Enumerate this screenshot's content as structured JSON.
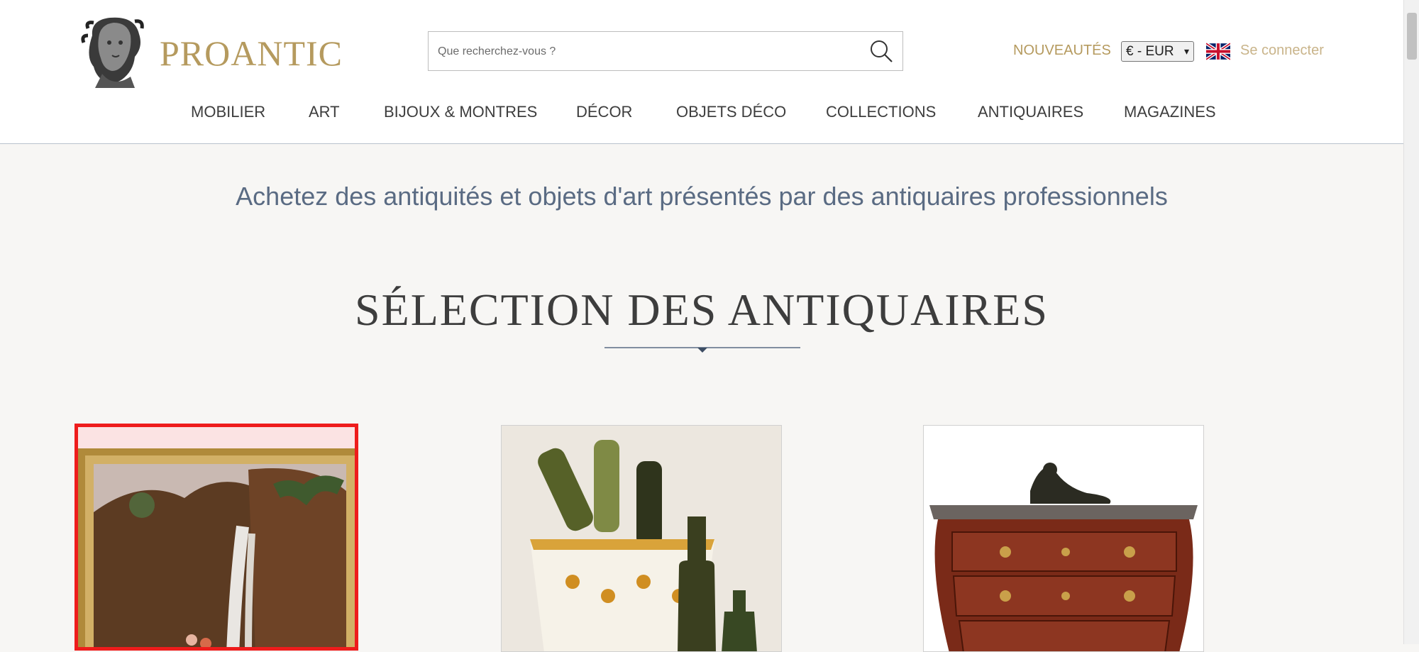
{
  "brand": {
    "name": "PROANTIC",
    "logo_icon": "sculpted-bust-icon"
  },
  "search": {
    "placeholder": "Que recherchez-vous ?",
    "icon": "search-icon"
  },
  "header_links": {
    "news": "NOUVEAUTÉS",
    "login": "Se connecter"
  },
  "currency": {
    "selected": "€ - EUR",
    "icon": "chevron-down-icon"
  },
  "language": {
    "icon": "uk-flag-icon"
  },
  "nav": {
    "items": [
      {
        "label": "MOBILIER"
      },
      {
        "label": "ART"
      },
      {
        "label": "BIJOUX & MONTRES"
      },
      {
        "label": "DÉCOR"
      },
      {
        "label": "OBJETS DÉCO"
      },
      {
        "label": "COLLECTIONS"
      },
      {
        "label": "ANTIQUAIRES"
      },
      {
        "label": "MAGAZINES"
      }
    ]
  },
  "hero": {
    "tagline": "Achetez des antiquités et objets d'art présentés par des antiquaires professionnels"
  },
  "section": {
    "title": "SÉLECTION DES ANTIQUAIRES"
  },
  "products": [
    {
      "image": "framed-waterfall-landscape-painting",
      "selected": true
    },
    {
      "image": "faience-wine-cooler-with-glass-bottles",
      "selected": false
    },
    {
      "image": "louis-xv-marble-top-commode-with-bronze-figure",
      "selected": false
    }
  ],
  "colors": {
    "accent_gold": "#b59a5e",
    "tagline_blue": "#5a6b83",
    "selection_red": "#ee1c1c"
  }
}
